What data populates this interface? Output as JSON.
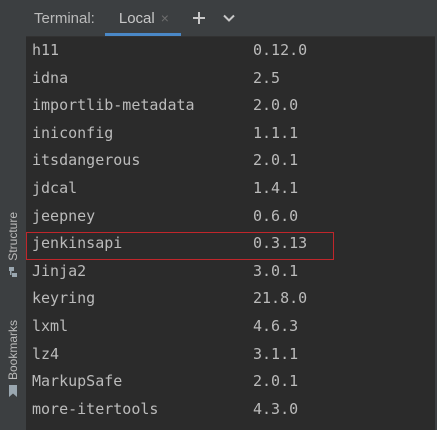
{
  "toolwindow": {
    "title": "Terminal:",
    "tab_label": "Local",
    "tab_close_glyph": "×",
    "new_tab_icon": "plus-icon",
    "dropdown_icon": "chevron-down-icon"
  },
  "stripe": {
    "structure_label": "Structure",
    "structure_icon": "structure-icon",
    "bookmarks_label": "Bookmarks",
    "bookmarks_icon": "bookmark-icon"
  },
  "packages": [
    {
      "name": "h11",
      "version": "0.12.0"
    },
    {
      "name": "idna",
      "version": "2.5"
    },
    {
      "name": "importlib-metadata",
      "version": "2.0.0"
    },
    {
      "name": "iniconfig",
      "version": "1.1.1"
    },
    {
      "name": "itsdangerous",
      "version": "2.0.1"
    },
    {
      "name": "jdcal",
      "version": "1.4.1"
    },
    {
      "name": "jeepney",
      "version": "0.6.0"
    },
    {
      "name": "jenkinsapi",
      "version": "0.3.13"
    },
    {
      "name": "Jinja2",
      "version": "3.0.1"
    },
    {
      "name": "keyring",
      "version": "21.8.0"
    },
    {
      "name": "lxml",
      "version": "4.6.3"
    },
    {
      "name": "lz4",
      "version": "3.1.1"
    },
    {
      "name": "MarkupSafe",
      "version": "2.0.1"
    },
    {
      "name": "more-itertools",
      "version": "4.3.0"
    }
  ],
  "colors": {
    "background": "#2b2b2b",
    "panel": "#3c3f41",
    "text": "#bbbbbb",
    "accent": "#4a88c7",
    "highlight_border": "#c0262b"
  }
}
